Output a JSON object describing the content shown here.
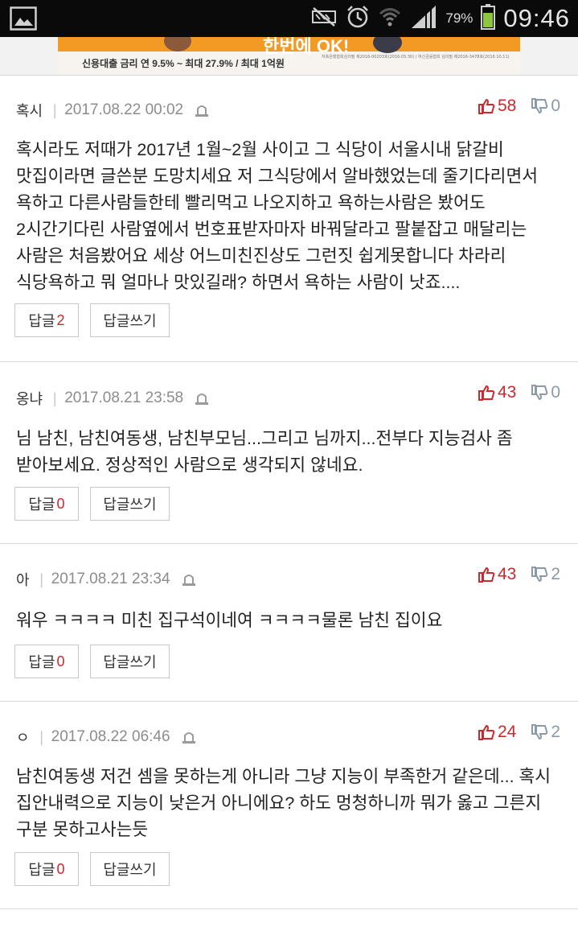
{
  "status_bar": {
    "battery_percent": "79%",
    "time": "09:46",
    "icons": [
      "gallery-icon",
      "mute-icon",
      "alarm-icon",
      "wifi-icon",
      "signal-icon",
      "battery-icon"
    ]
  },
  "banner": {
    "headline": "신용대출 금리 연 9.5% ~ 최대 27.9% / 최대 1억원",
    "top_text": "한번에 OK!",
    "fine_print": "저축은행협회심의필 제2016-00203호(2016.05.30) / 여신금융협회 심의필 제2016-3478호(2016.10.11)"
  },
  "labels": {
    "reply": "답글",
    "write_reply": "답글쓰기"
  },
  "comments": [
    {
      "author": "혹시",
      "date": "2017.08.22 00:02",
      "upvotes": "58",
      "downvotes": "0",
      "body": "혹시라도 저때가 2017년 1월~2월 사이고 그 식당이 서울시내 닭갈비 맛집이라면 글쓴분 도망치세요 저 그식당에서 알바했었는데 줄기다리면서 욕하고 다른사람들한테 빨리먹고 나오지하고 욕하는사람은 봤어도 2시간기다린 사람옆에서 번호표받자마자 바꿔달라고 팔붙잡고 매달리는 사람은 처음봤어요 세상 어느미친진상도 그런짓 쉽게못합니다 차라리 식당욕하고 뭐 얼마나 맛있길래? 하면서 욕하는 사람이 낫죠....",
      "reply_count": "2"
    },
    {
      "author": "옹냐",
      "date": "2017.08.21 23:58",
      "upvotes": "43",
      "downvotes": "0",
      "body": "님 남친, 남친여동생, 남친부모님...그리고 님까지...전부다 지능검사 좀 받아보세요. 정상적인 사람으로 생각되지 않네요.",
      "reply_count": "0"
    },
    {
      "author": "아",
      "date": "2017.08.21 23:34",
      "upvotes": "43",
      "downvotes": "2",
      "body": "워우 ㅋㅋㅋㅋ 미친 집구석이네여 ㅋㅋㅋㅋ물론 남친 집이요",
      "reply_count": "0"
    },
    {
      "author": "ㅇ",
      "date": "2017.08.22 06:46",
      "upvotes": "24",
      "downvotes": "2",
      "body": "남친여동생 저건 셈을 못하는게 아니라 그냥 지능이 부족한거 같은데... 혹시 집안내력으로 지능이 낮은거 아니에요? 하도 멍청하니까 뭐가 옳고 그른지 구분 못하고사는듯",
      "reply_count": "0"
    }
  ]
}
